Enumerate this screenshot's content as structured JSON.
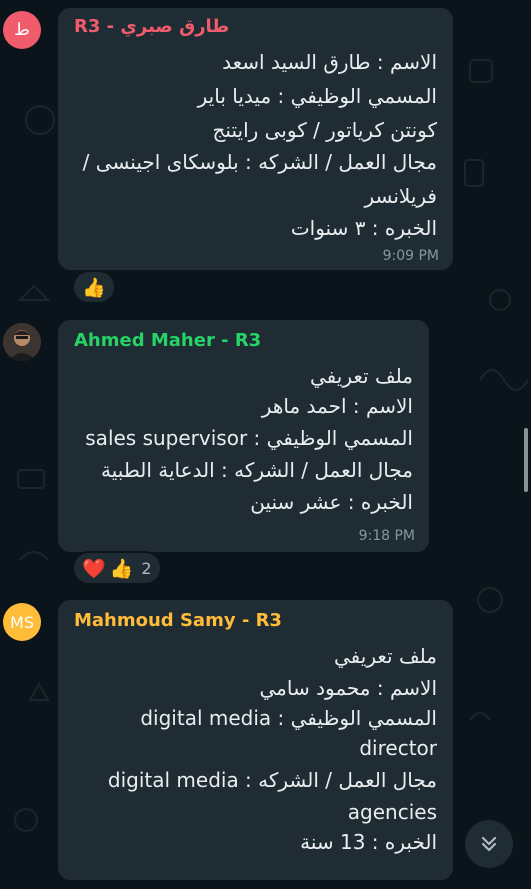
{
  "messages": [
    {
      "sender": "طارق صبري - R3",
      "sender_color": "#f15c6d",
      "avatar": {
        "initial": "ط",
        "bg": "#f15c6d",
        "fg": "#ffffff"
      },
      "lines": [
        "الاسم : طارق السيد اسعد",
        "المسمي الوظيفي :  ميديا باير",
        "كونتن كرياتور / كوبى رايتنج",
        "مجال العمل / الشركه : بلوسكاى اجينسى /",
        "فريلانسر",
        "الخبره : ٣ سنوات"
      ],
      "time": "9:09 PM",
      "reactions": {
        "emojis": [
          "👍"
        ],
        "count": ""
      }
    },
    {
      "sender": "Ahmed Maher - R3",
      "sender_color": "#25d366",
      "avatar": {
        "initial": "",
        "bg": "#3a3a3a",
        "fg": "#ffffff"
      },
      "lines": [
        "ملف تعريفي",
        "الاسم : احمد ماهر",
        "المسمي الوظيفي : sales supervisor",
        "مجال العمل / الشركه : الدعاية الطبية",
        "الخبره : عشر سنين"
      ],
      "time": "9:18 PM",
      "reactions": {
        "emojis": [
          "❤️",
          "👍"
        ],
        "count": "2"
      }
    },
    {
      "sender": "Mahmoud Samy - R3",
      "sender_color": "#ffbc38",
      "avatar": {
        "initial": "MS",
        "bg": "#ffbc38",
        "fg": "#ffffff"
      },
      "lines": [
        "ملف تعريفي",
        "الاسم :  محمود سامي",
        "المسمي الوظيفي : digital media",
        "director",
        "مجال العمل / الشركه : digital media",
        "agencies",
        "الخبره : 13 سنة"
      ],
      "time": "",
      "reactions": null
    }
  ],
  "icons": {
    "scroll_down": "double-chevron-down-icon"
  },
  "colors": {
    "background": "#0b141a",
    "bubble": "#202c33",
    "meta_text": "#8696a0"
  }
}
